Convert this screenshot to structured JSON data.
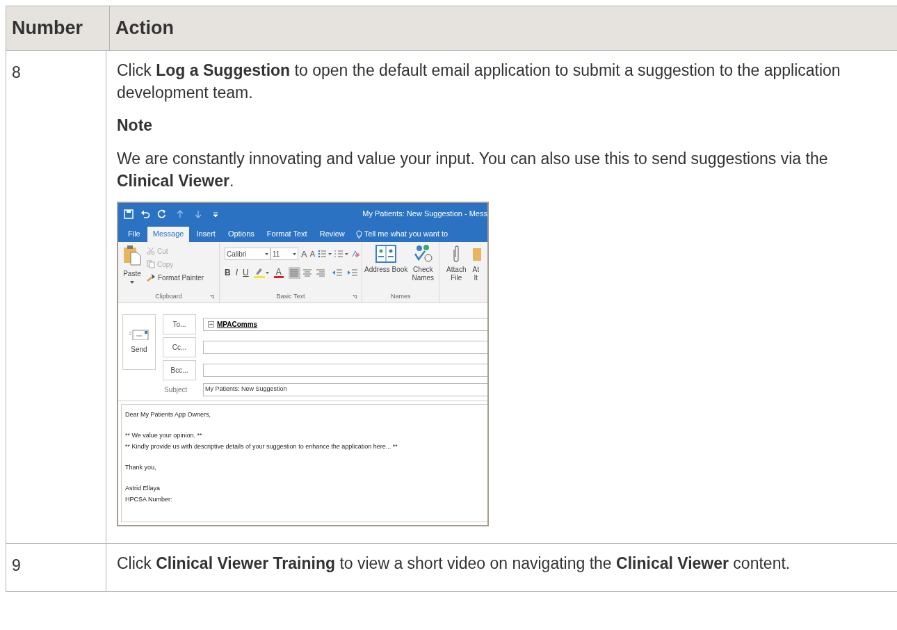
{
  "table": {
    "columns": [
      "Number",
      "Action"
    ],
    "rows": [
      {
        "number": "8",
        "blocks": [
          {
            "kind": "paragraph",
            "text": "Click **Log a Suggestion** to open the default email application to submit a suggestion to the application development team."
          },
          {
            "kind": "heading",
            "text": "Note"
          },
          {
            "kind": "paragraph",
            "text": "We are constantly innovating and value your input. You can also use this to send suggestions via the **Clinical Viewer**."
          },
          {
            "kind": "screenshot"
          }
        ]
      },
      {
        "number": "9",
        "blocks": [
          {
            "kind": "paragraph",
            "text": "Click **Clinical Viewer Training** to view a short video on navigating the **Clinical Viewer** content."
          }
        ]
      }
    ]
  },
  "email_window": {
    "title": "My Patients: New Suggestion - Mess",
    "tabs": [
      {
        "label": "File",
        "selected": false
      },
      {
        "label": "Message",
        "selected": true
      },
      {
        "label": "Insert",
        "selected": false
      },
      {
        "label": "Options",
        "selected": false
      },
      {
        "label": "Format Text",
        "selected": false
      },
      {
        "label": "Review",
        "selected": false
      }
    ],
    "tell_me": "Tell me what you want to",
    "clipboard": {
      "paste": "Paste",
      "cut": {
        "label": "Cut",
        "disabled": true
      },
      "copy": {
        "label": "Copy",
        "disabled": true
      },
      "format_painter": {
        "label": "Format Painter",
        "disabled": false
      },
      "label": "Clipboard"
    },
    "basic_text": {
      "font": "Calibri",
      "size": "11",
      "grow": "A",
      "shrink": "A",
      "bold": "B",
      "italic": "I",
      "underline": "U",
      "font_color": "A",
      "alignment": [
        {
          "selected": true
        },
        {
          "selected": false
        },
        {
          "selected": false
        }
      ],
      "label": "Basic Text"
    },
    "names": {
      "address_book": "Address Book",
      "check_names": "Check Names",
      "label": "Names"
    },
    "attach_file": "Attach File",
    "attach_item": "At It",
    "send": "Send",
    "recipients": [
      {
        "label": "To...",
        "value": "MPAComms"
      },
      {
        "label": "Cc..."
      },
      {
        "label": "Bcc..."
      }
    ],
    "subject": {
      "label": "Subject",
      "value": "My Patients: New Suggestion"
    },
    "body": [
      [
        "Dear My Patients App Owners,"
      ],
      [
        "** We value your opinion. **",
        "** Kindly provide us with descriptive details of your suggestion to enhance the application here... **"
      ],
      [
        "Thank you,"
      ],
      [
        "Astrid Ellaya",
        "HPCSA Number:"
      ]
    ]
  }
}
